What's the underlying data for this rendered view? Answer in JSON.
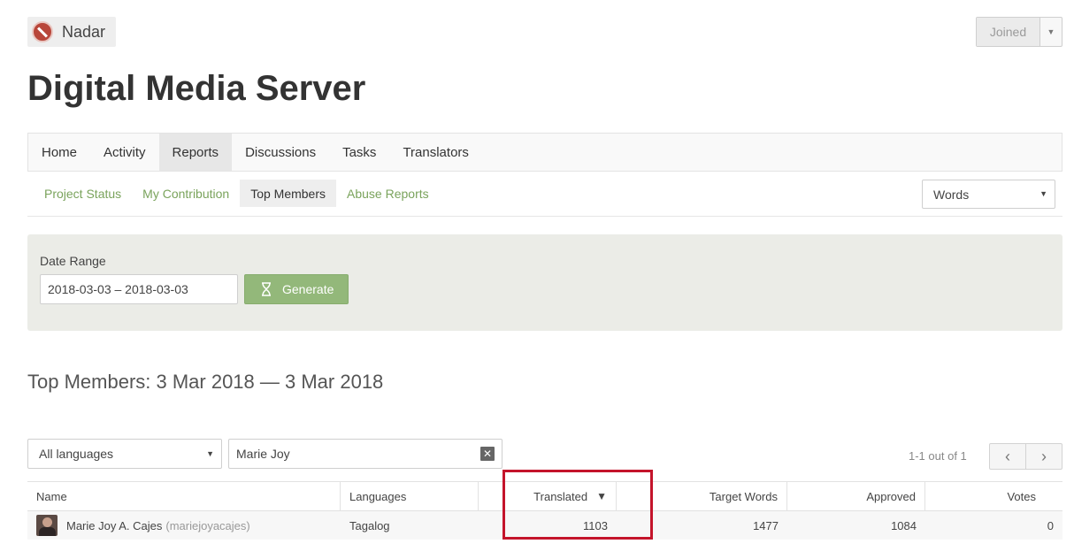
{
  "header": {
    "org_name": "Nadar",
    "joined_label": "Joined",
    "project_title": "Digital Media Server"
  },
  "main_nav": [
    {
      "label": "Home",
      "active": false
    },
    {
      "label": "Activity",
      "active": false
    },
    {
      "label": "Reports",
      "active": true
    },
    {
      "label": "Discussions",
      "active": false
    },
    {
      "label": "Tasks",
      "active": false
    },
    {
      "label": "Translators",
      "active": false
    }
  ],
  "sub_nav": [
    {
      "label": "Project Status",
      "active": false
    },
    {
      "label": "My Contribution",
      "active": false
    },
    {
      "label": "Top Members",
      "active": true
    },
    {
      "label": "Abuse Reports",
      "active": false
    }
  ],
  "unit_select": {
    "value": "Words"
  },
  "date_range": {
    "label": "Date Range",
    "value": "2018-03-03 – 2018-03-03",
    "generate_label": "Generate"
  },
  "section_title": "Top Members: 3 Mar 2018 — 3 Mar 2018",
  "filters": {
    "language": "All languages",
    "search_value": "Marie Joy"
  },
  "pagination": {
    "text": "1-1 out of 1",
    "prev": "‹",
    "next": "›"
  },
  "table": {
    "columns": [
      "Name",
      "Languages",
      "Translated",
      "Target Words",
      "Approved",
      "Votes"
    ],
    "sort_indicator": "▼",
    "rows": [
      {
        "name": "Marie Joy A. Cajes",
        "username": "(mariejoyacajes)",
        "language": "Tagalog",
        "translated": "1103",
        "target_words": "1477",
        "approved": "1084",
        "votes": "0"
      }
    ]
  },
  "colors": {
    "accent_green": "#7aa35c",
    "button_green": "#93b87a",
    "highlight_red": "#c4142b"
  }
}
